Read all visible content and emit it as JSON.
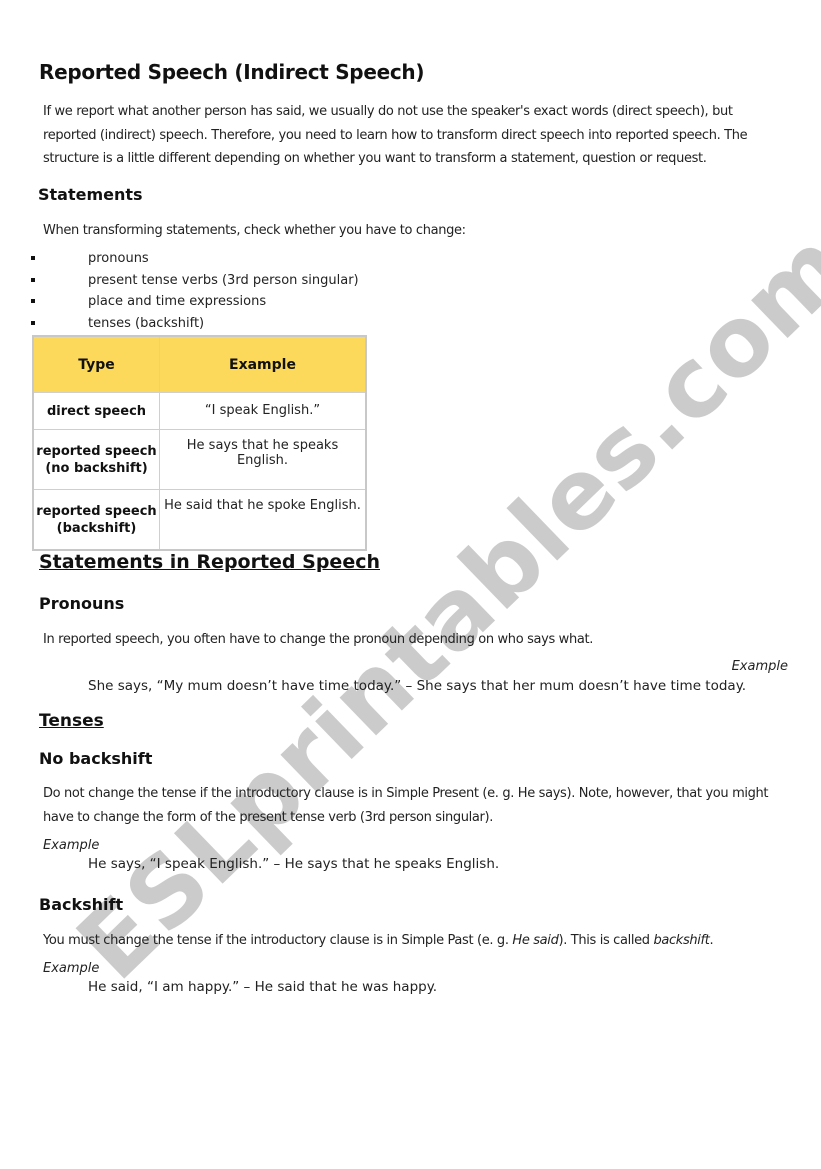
{
  "document": {
    "title": "Reported Speech (Indirect Speech)",
    "intro": [
      "If we report what another person has said, we usually do not use the speaker's exact words (direct speech), but",
      "reported (indirect) speech. Therefore, you need to learn how to transform direct speech into reported speech. The",
      "structure is a little different depending on whether you want to transform a statement, question or request."
    ],
    "statements": {
      "heading": "Statements",
      "lead": "When transforming statements, check whether you have to change:",
      "bullets": [
        "pronouns",
        "present tense verbs (3rd person singular)",
        "place and time expressions",
        "tenses (backshift)"
      ],
      "table": {
        "headers": [
          "Type",
          "Example"
        ],
        "header_color": "#fcd95a",
        "rows": [
          {
            "type": "direct speech",
            "type_line2": "",
            "example": "“I speak English.”"
          },
          {
            "type": "reported speech",
            "type_line2": "(no backshift)",
            "example": "He says that he speaks English."
          },
          {
            "type": "reported speech",
            "type_line2": "(backshift)",
            "example": "He said that he spoke English."
          }
        ]
      }
    },
    "section2": {
      "heading": "Statements in Reported Speech",
      "pronouns": {
        "heading": "Pronouns",
        "text": "In reported speech, you often have to change the pronoun depending on who says what.",
        "example_label": "Example",
        "example": "She says, “My mum doesn’t have time today.” – She says that her mum doesn’t have time today."
      },
      "tenses": {
        "heading": "Tenses",
        "no_backshift": {
          "heading": "No backshift",
          "text": [
            "Do not change the tense if the introductory clause is in Simple Present (e. g. He says). Note, however, that you might",
            "have to change the form of the present tense verb (3rd person singular)."
          ],
          "example_label": "Example",
          "example": "He says, “I speak English.” – He says that he speaks English."
        },
        "backshift": {
          "heading": "Backshift",
          "text_before": "You must change the tense if the introductory clause is in Simple Past (e. g. ",
          "text_italic1": "He said",
          "text_middle": "). This is called ",
          "text_italic2": "backshift",
          "text_after": ".",
          "example_label": "Example",
          "example": "He said, “I am happy.” – He said that he was happy."
        }
      }
    },
    "watermark": "ESLprintables.com"
  }
}
